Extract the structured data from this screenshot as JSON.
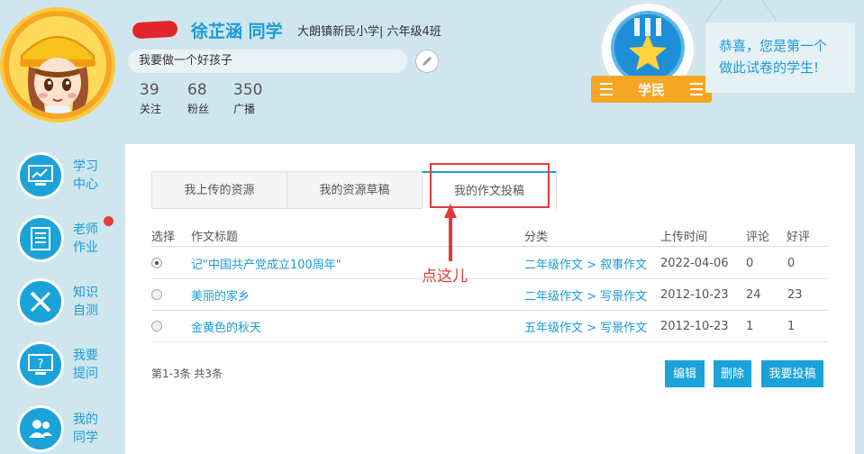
{
  "profile": {
    "name": "徐芷涵 同学",
    "school": "大朗镇新民小学| 六年级4班",
    "bio": "我要做一个好孩子",
    "stats": [
      {
        "num": "39",
        "label": "关注"
      },
      {
        "num": "68",
        "label": "粉丝"
      },
      {
        "num": "350",
        "label": "广播"
      }
    ]
  },
  "badge": {
    "ribbon_label": "学民",
    "message_line1": "恭喜，您是第一个",
    "message_line2": "做此试卷的学生!"
  },
  "sidebar": {
    "items": [
      {
        "line1": "学习",
        "line2": "中心",
        "icon": "monitor-chart-icon"
      },
      {
        "line1": "老师",
        "line2": "作业",
        "icon": "document-icon"
      },
      {
        "line1": "知识",
        "line2": "自测",
        "icon": "ruler-pencil-icon"
      },
      {
        "line1": "我要",
        "line2": "提问",
        "icon": "question-screen-icon"
      },
      {
        "line1": "我的",
        "line2": "同学",
        "icon": "people-icon"
      }
    ]
  },
  "tabs": [
    {
      "label": "我上传的资源"
    },
    {
      "label": "我的资源草稿"
    },
    {
      "label": "我的作文投稿"
    }
  ],
  "table": {
    "headers": [
      "选择",
      "作文标题",
      "分类",
      "上传时间",
      "评论",
      "好评"
    ],
    "rows": [
      {
        "selected": true,
        "title": "记\"中国共产党成立100周年\"",
        "category": "二年级作文 > 叙事作文",
        "date": "2022-04-06",
        "comments": "0",
        "likes": "0"
      },
      {
        "selected": false,
        "title": "美丽的家乡",
        "category": "二年级作文 > 写景作文",
        "date": "2012-10-23",
        "comments": "24",
        "likes": "23"
      },
      {
        "selected": false,
        "title": "金黄色的秋天",
        "category": "五年级作文 > 写景作文",
        "date": "2012-10-23",
        "comments": "1",
        "likes": "1"
      }
    ]
  },
  "annotation": "点这儿",
  "pager": "第1-3条 共3条",
  "buttons": {
    "edit": "编辑",
    "delete": "删除",
    "submit": "我要投稿"
  },
  "colors": {
    "accent": "#1aa3d9",
    "annotation": "#e33b3b",
    "ribbon": "#f5a623"
  }
}
